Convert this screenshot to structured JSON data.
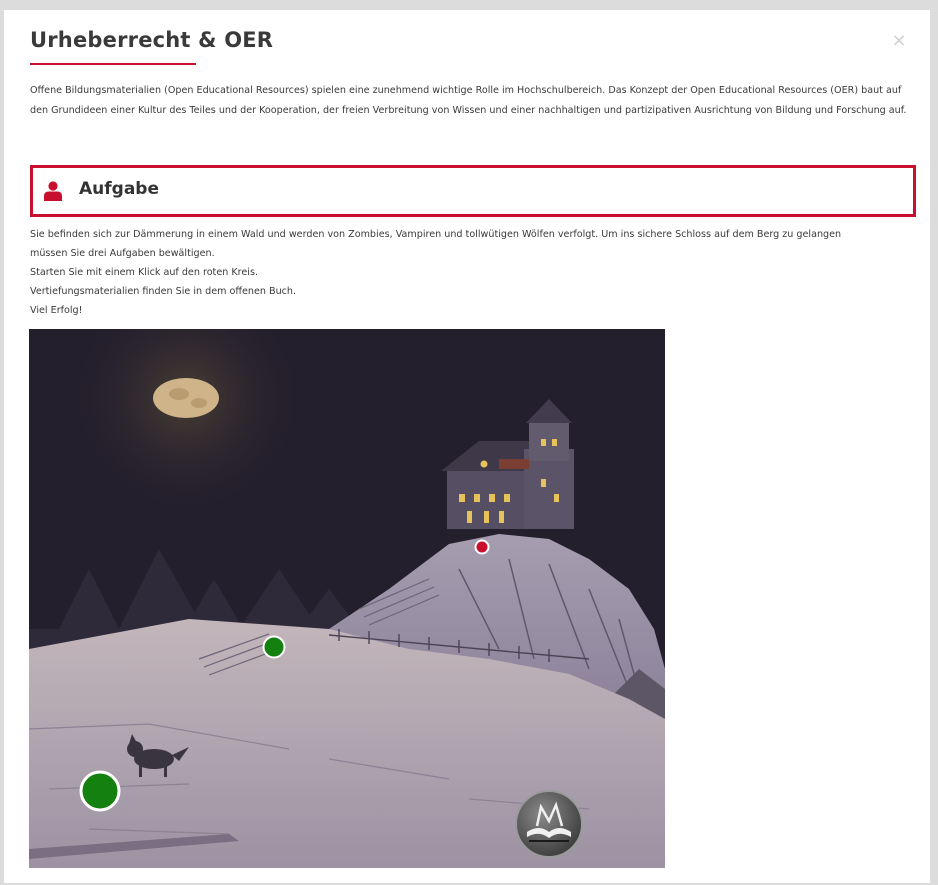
{
  "dialog": {
    "title": "Urheberrecht & OER",
    "close_symbol": "×",
    "intro": "Offene Bildungsmaterialien (Open Educational Resources) spielen eine zunehmend wichtige Rolle im Hochschulbereich. Das Konzept der Open Educational Resources (OER) baut auf den Grundideen einer Kultur des Teiles und der Kooperation, der freien Verbreitung von Wissen und einer nachhaltigen und partizipativen Ausrichtung von Bildung und Forschung auf."
  },
  "task": {
    "label": "Aufgabe",
    "icon": "user-icon",
    "accent_color": "#c8102e",
    "lines": [
      "Sie befinden sich zur Dämmerung in einem Wald und werden von Zombies, Vampiren und tollwütigen Wölfen verfolgt. Um ins sichere Schloss auf dem Berg zu gelangen",
      "müssen Sie drei Aufgaben bewältigen.",
      "Starten Sie mit einem Klick auf den roten Kreis.",
      "Vertiefungsmaterialien finden Sie in dem offenen Buch.",
      "Viel Erfolg!"
    ]
  },
  "scene": {
    "hotspots": [
      {
        "name": "castle-hotspot",
        "color": "#c8102e",
        "state": "start"
      },
      {
        "name": "path-hotspot",
        "color": "#14800f",
        "state": "done"
      },
      {
        "name": "forest-hotspot",
        "color": "#14800f",
        "state": "done"
      }
    ],
    "book_icon": "open-book-icon"
  }
}
